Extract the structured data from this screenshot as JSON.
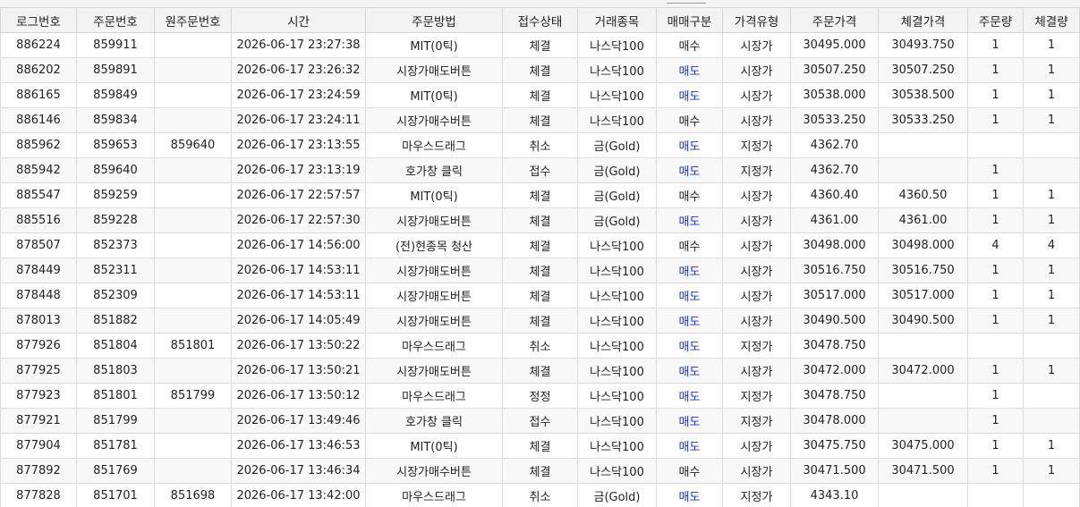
{
  "columns": [
    "로그번호",
    "주문번호",
    "원주문번호",
    "시간",
    "주문방법",
    "접수상태",
    "거래종목",
    "매매구분",
    "가격유형",
    "주문가격",
    "체결가격",
    "주문량",
    "체결량"
  ],
  "side_colors": {
    "sell": "#1a2fd6",
    "buy": "#222222"
  },
  "rows": [
    [
      "886224",
      "859911",
      "",
      "2026-06-17 23:27:38",
      "MIT(0틱)",
      "체결",
      "나스닥100",
      "매수",
      "시장가",
      "30495.000",
      "30493.750",
      "1",
      "1"
    ],
    [
      "886202",
      "859891",
      "",
      "2026-06-17 23:26:32",
      "시장가매도버튼",
      "체결",
      "나스닥100",
      "매도",
      "시장가",
      "30507.250",
      "30507.250",
      "1",
      "1"
    ],
    [
      "886165",
      "859849",
      "",
      "2026-06-17 23:24:59",
      "MIT(0틱)",
      "체결",
      "나스닥100",
      "매도",
      "시장가",
      "30538.000",
      "30538.500",
      "1",
      "1"
    ],
    [
      "886146",
      "859834",
      "",
      "2026-06-17 23:24:11",
      "시장가매수버튼",
      "체결",
      "나스닥100",
      "매수",
      "시장가",
      "30533.250",
      "30533.250",
      "1",
      "1"
    ],
    [
      "885962",
      "859653",
      "859640",
      "2026-06-17 23:13:55",
      "마우스드래그",
      "취소",
      "금(Gold)",
      "매도",
      "지정가",
      "4362.70",
      "",
      "",
      ""
    ],
    [
      "885942",
      "859640",
      "",
      "2026-06-17 23:13:19",
      "호가창 클릭",
      "접수",
      "금(Gold)",
      "매도",
      "지정가",
      "4362.70",
      "",
      "1",
      ""
    ],
    [
      "885547",
      "859259",
      "",
      "2026-06-17 22:57:57",
      "MIT(0틱)",
      "체결",
      "금(Gold)",
      "매수",
      "시장가",
      "4360.40",
      "4360.50",
      "1",
      "1"
    ],
    [
      "885516",
      "859228",
      "",
      "2026-06-17 22:57:30",
      "시장가매도버튼",
      "체결",
      "금(Gold)",
      "매도",
      "시장가",
      "4361.00",
      "4361.00",
      "1",
      "1"
    ],
    [
      "878507",
      "852373",
      "",
      "2026-06-17 14:56:00",
      "(전)현종목 청산",
      "체결",
      "나스닥100",
      "매수",
      "시장가",
      "30498.000",
      "30498.000",
      "4",
      "4"
    ],
    [
      "878449",
      "852311",
      "",
      "2026-06-17 14:53:11",
      "시장가매도버튼",
      "체결",
      "나스닥100",
      "매도",
      "시장가",
      "30516.750",
      "30516.750",
      "1",
      "1"
    ],
    [
      "878448",
      "852309",
      "",
      "2026-06-17 14:53:11",
      "시장가매도버튼",
      "체결",
      "나스닥100",
      "매도",
      "시장가",
      "30517.000",
      "30517.000",
      "1",
      "1"
    ],
    [
      "878013",
      "851882",
      "",
      "2026-06-17 14:05:49",
      "시장가매도버튼",
      "체결",
      "나스닥100",
      "매도",
      "시장가",
      "30490.500",
      "30490.500",
      "1",
      "1"
    ],
    [
      "877926",
      "851804",
      "851801",
      "2026-06-17 13:50:22",
      "마우스드래그",
      "취소",
      "나스닥100",
      "매도",
      "지정가",
      "30478.750",
      "",
      "",
      ""
    ],
    [
      "877925",
      "851803",
      "",
      "2026-06-17 13:50:21",
      "시장가매도버튼",
      "체결",
      "나스닥100",
      "매도",
      "시장가",
      "30472.000",
      "30472.000",
      "1",
      "1"
    ],
    [
      "877923",
      "851801",
      "851799",
      "2026-06-17 13:50:12",
      "마우스드래그",
      "정정",
      "나스닥100",
      "매도",
      "지정가",
      "30478.750",
      "",
      "1",
      ""
    ],
    [
      "877921",
      "851799",
      "",
      "2026-06-17 13:49:46",
      "호가창 클릭",
      "접수",
      "나스닥100",
      "매도",
      "지정가",
      "30478.000",
      "",
      "1",
      ""
    ],
    [
      "877904",
      "851781",
      "",
      "2026-06-17 13:46:53",
      "MIT(0틱)",
      "체결",
      "나스닥100",
      "매도",
      "시장가",
      "30475.750",
      "30475.000",
      "1",
      "1"
    ],
    [
      "877892",
      "851769",
      "",
      "2026-06-17 13:46:34",
      "시장가매수버튼",
      "체결",
      "나스닥100",
      "매수",
      "시장가",
      "30471.500",
      "30471.500",
      "1",
      "1"
    ],
    [
      "877828",
      "851701",
      "851698",
      "2026-06-17 13:42:00",
      "마우스드래그",
      "취소",
      "금(Gold)",
      "매도",
      "지정가",
      "4343.10",
      "",
      "",
      ""
    ]
  ]
}
